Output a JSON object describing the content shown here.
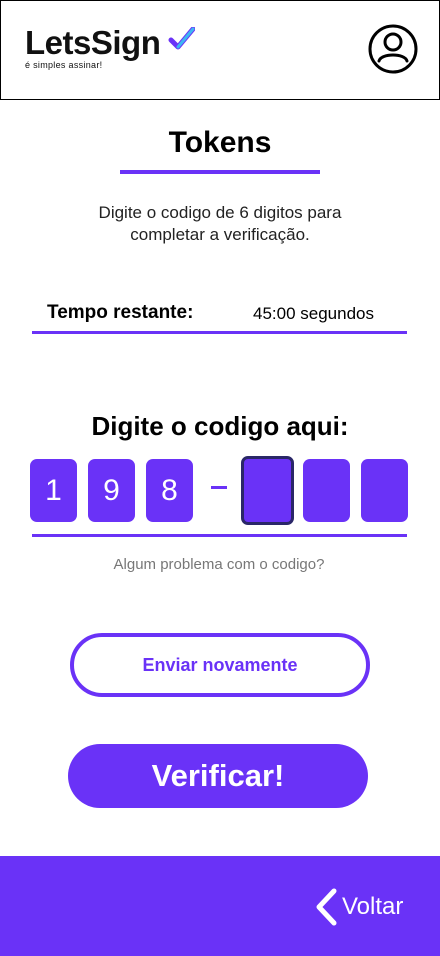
{
  "header": {
    "brand": "LetsSign",
    "tagline": "é simples assinar!",
    "avatar_icon": "user-circle-icon"
  },
  "main": {
    "title": "Tokens",
    "description": "Digite o codigo de 6 digitos para completar a verificação.",
    "timer": {
      "label": "Tempo restante:",
      "value": "45:00 segundos"
    },
    "code_title": "Digite o codigo aqui:",
    "digits": [
      "1",
      "9",
      "8",
      "",
      "",
      ""
    ],
    "separator": "-",
    "problem_link": "Algum problema com o codigo?",
    "resend_button": "Enviar novamente",
    "verify_button": "Verificar!"
  },
  "footer": {
    "back_label": "Voltar",
    "back_icon": "chevron-left-icon"
  },
  "colors": {
    "accent": "#6a32f7",
    "active_border": "#2a2768"
  }
}
